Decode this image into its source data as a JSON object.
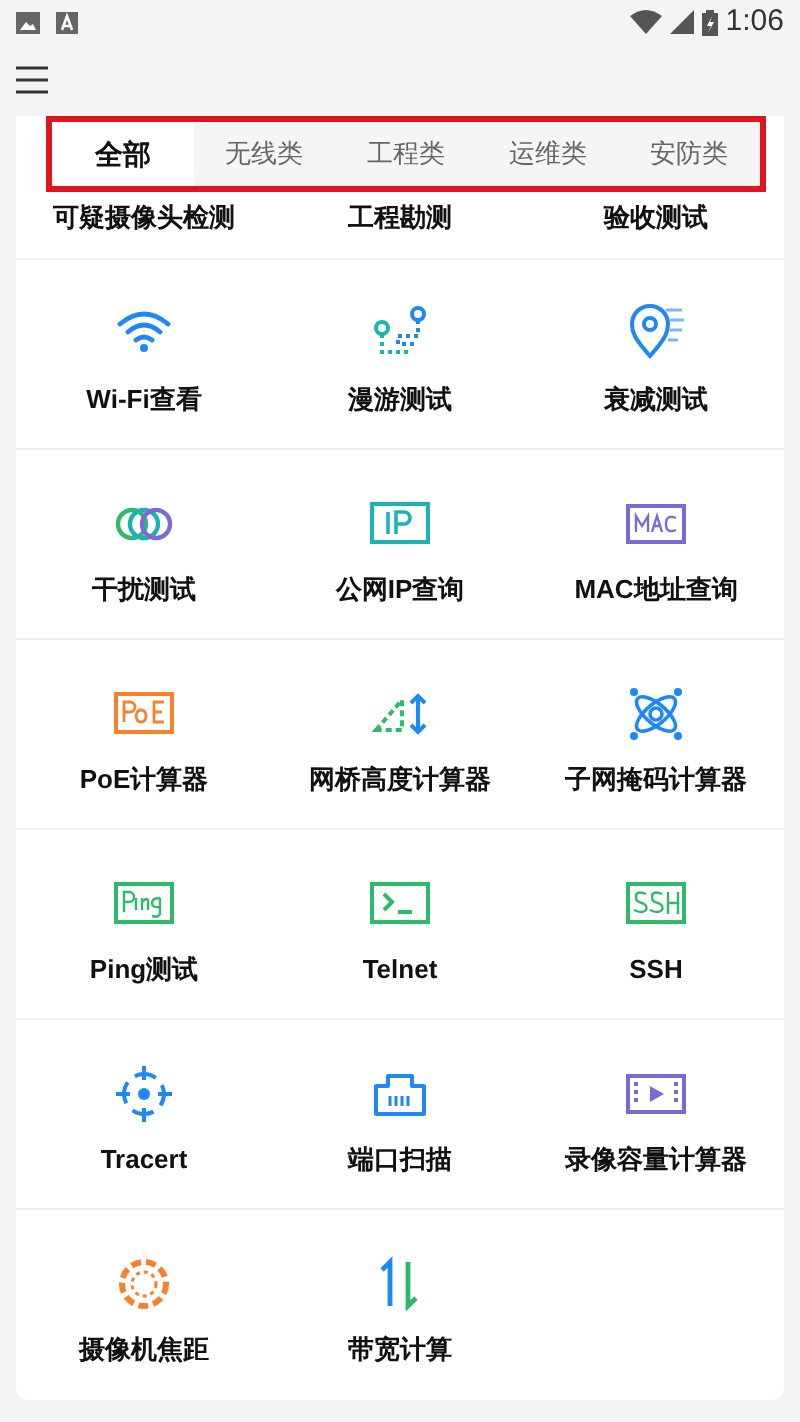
{
  "status_bar": {
    "time": "1:06"
  },
  "tabs": [
    {
      "label": "全部",
      "selected": true
    },
    {
      "label": "无线类",
      "selected": false
    },
    {
      "label": "工程类",
      "selected": false
    },
    {
      "label": "运维类",
      "selected": false
    },
    {
      "label": "安防类",
      "selected": false
    }
  ],
  "partial_row": [
    "可疑摄像头检测",
    "工程勘测",
    "验收测试"
  ],
  "tools": [
    {
      "label": "Wi-Fi查看"
    },
    {
      "label": "漫游测试"
    },
    {
      "label": "衰减测试"
    },
    {
      "label": "干扰测试"
    },
    {
      "label": "公网IP查询"
    },
    {
      "label": "MAC地址查询"
    },
    {
      "label": "PoE计算器"
    },
    {
      "label": "网桥高度计算器"
    },
    {
      "label": "子网掩码计算器"
    },
    {
      "label": "Ping测试"
    },
    {
      "label": "Telnet"
    },
    {
      "label": "SSH"
    },
    {
      "label": "Tracert"
    },
    {
      "label": "端口扫描"
    },
    {
      "label": "录像容量计算器"
    },
    {
      "label": "摄像机焦距"
    },
    {
      "label": "带宽计算"
    }
  ]
}
